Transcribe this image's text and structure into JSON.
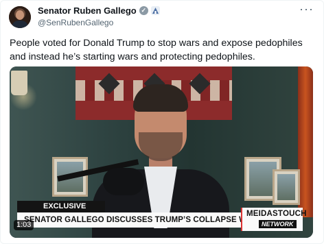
{
  "tweet": {
    "author_name": "Senator Ruben Gallego",
    "author_handle": "@SenRubenGallego",
    "text": "People voted for Donald Trump to stop wars and expose pedophiles and instead he’s starting wars and protecting pedophiles.",
    "more_label": "···"
  },
  "icons": {
    "verified": "verified-check-icon",
    "government": "government-badge-icon"
  },
  "video": {
    "badge": "EXCLUSIVE",
    "headline": "SENATOR GALLEGO DISCUSSES TRUMP’S COLLAPSE WITH LATINO VOTERS",
    "brand_top": "MEIDASTOUCH",
    "brand_bottom": "NETWORK",
    "duration": "1:03"
  },
  "colors": {
    "text": "#0f1419",
    "muted": "#536471",
    "verified": "#8c9aa5"
  }
}
